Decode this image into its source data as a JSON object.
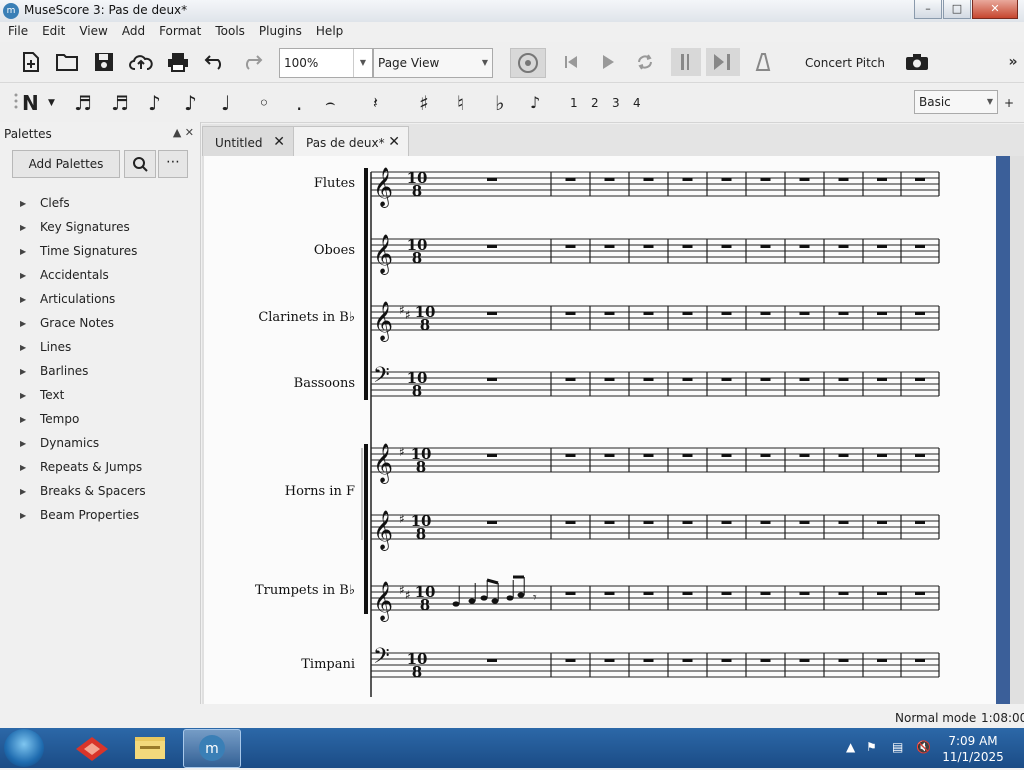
{
  "window": {
    "title": "MuseScore 3: Pas de deux*",
    "app_icon": "musescore-icon"
  },
  "menu": [
    "File",
    "Edit",
    "View",
    "Add",
    "Format",
    "Tools",
    "Plugins",
    "Help"
  ],
  "toolbar": {
    "zoom": "100%",
    "view_mode": "Page View",
    "concert_pitch": "Concert Pitch"
  },
  "note_input": {
    "voices": [
      "1",
      "2",
      "3",
      "4"
    ],
    "workspace": "Basic",
    "add_workspace": "+"
  },
  "palettes": {
    "title": "Palettes",
    "add_button": "Add Palettes",
    "items": [
      "Clefs",
      "Key Signatures",
      "Time Signatures",
      "Accidentals",
      "Articulations",
      "Grace Notes",
      "Lines",
      "Barlines",
      "Text",
      "Tempo",
      "Dynamics",
      "Repeats & Jumps",
      "Breaks & Spacers",
      "Beam Properties"
    ]
  },
  "tabs": [
    {
      "label": "Untitled"
    },
    {
      "label": "Pas de deux*",
      "active": true
    }
  ],
  "score": {
    "time_signature": {
      "top": "10",
      "bottom": "8"
    },
    "instruments": [
      "Flutes",
      "Oboes",
      "Clarinets in B♭",
      "Bassoons",
      "Horns in F",
      "Trumpets in B♭",
      "Timpani"
    ]
  },
  "status": {
    "mode": "Normal mode",
    "position": "1:08:000"
  },
  "taskbar": {
    "time": "7:09 AM",
    "date": "11/1/2025"
  },
  "colors": {
    "accent": "#3b5f99",
    "taskbar": "#1f579a",
    "selected_tab": "#f2f2f2"
  }
}
